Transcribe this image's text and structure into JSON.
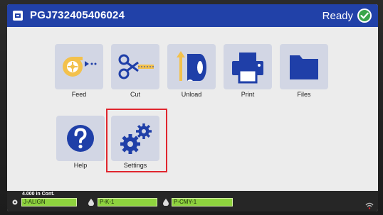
{
  "header": {
    "printer_icon": "printer-status-icon",
    "serial": "PGJ732405406024",
    "status": "Ready",
    "status_icon": "check-circle-icon"
  },
  "menu": [
    {
      "label": "Feed",
      "icon": "feed-icon"
    },
    {
      "label": "Cut",
      "icon": "scissors-icon"
    },
    {
      "label": "Unload",
      "icon": "unload-icon"
    },
    {
      "label": "Print",
      "icon": "printer-icon"
    },
    {
      "label": "Files",
      "icon": "folder-icon"
    },
    {
      "label": "Help",
      "icon": "help-icon"
    },
    {
      "label": "Settings",
      "icon": "gears-icon"
    }
  ],
  "status_bar": {
    "media_length": "4.000 in Cont.",
    "media": [
      {
        "label": "J-ALIGN",
        "icon": "label-roll-icon"
      },
      {
        "label": "P-K-1",
        "icon": "ink-drop-icon"
      },
      {
        "label": "P-CMY-1",
        "icon": "ink-drop-icon"
      }
    ],
    "wifi_icon": "wifi-icon"
  },
  "colors": {
    "header": "#2141a8",
    "tile": "#d2d6e4",
    "icon_blue": "#1f3fa8",
    "icon_gold": "#f3c14c",
    "media_green": "#8ed33e",
    "highlight": "#e0262e",
    "ready": "#3aa54a"
  }
}
